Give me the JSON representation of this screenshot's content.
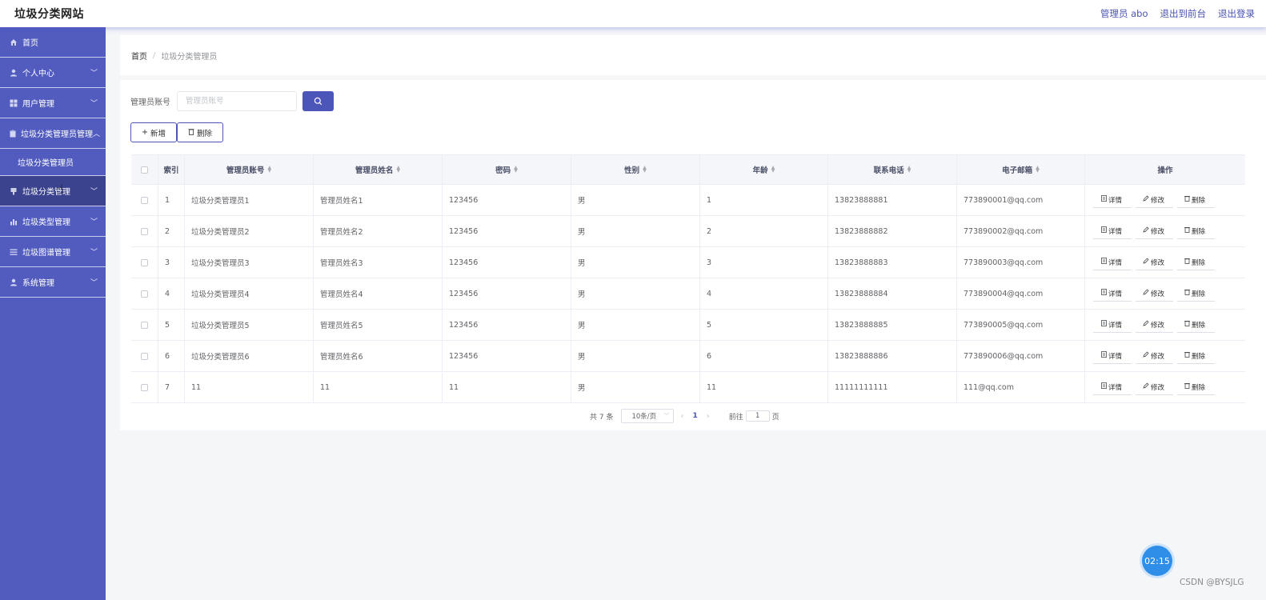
{
  "header": {
    "site_title": "垃圾分类网站",
    "admin_label": "管理员 abo",
    "to_front_label": "退出到前台",
    "logout_label": "退出登录"
  },
  "sidebar": {
    "items": [
      {
        "label": "首页",
        "icon": "home-icon",
        "chevron": ""
      },
      {
        "label": "个人中心",
        "icon": "user-icon",
        "chevron": "﹀"
      },
      {
        "label": "用户管理",
        "icon": "grid-icon",
        "chevron": "﹀"
      },
      {
        "label": "垃圾分类管理员管理",
        "icon": "clipboard-icon",
        "chevron": "︿"
      },
      {
        "label": "垃圾分类管理",
        "icon": "trash-icon",
        "chevron": "﹀"
      },
      {
        "label": "垃圾类型管理",
        "icon": "bar-chart-icon",
        "chevron": "﹀"
      },
      {
        "label": "垃圾图谱管理",
        "icon": "list-icon",
        "chevron": "﹀"
      },
      {
        "label": "系统管理",
        "icon": "user-icon",
        "chevron": "﹀"
      }
    ],
    "submenu_label": "垃圾分类管理员"
  },
  "breadcrumb": {
    "home": "首页",
    "sep": "/",
    "current": "垃圾分类管理员"
  },
  "search": {
    "label": "管理员账号",
    "placeholder": "管理员账号",
    "value": ""
  },
  "actions": {
    "add_label": "新增",
    "delete_label": "删除"
  },
  "table": {
    "headers": {
      "index": "索引",
      "account": "管理员账号",
      "name": "管理员姓名",
      "password": "密码",
      "gender": "性别",
      "age": "年龄",
      "phone": "联系电话",
      "email": "电子邮箱",
      "ops": "操作"
    },
    "op_labels": {
      "detail": "详情",
      "edit": "修改",
      "delete": "删除"
    },
    "rows": [
      {
        "index": "1",
        "account": "垃圾分类管理员1",
        "name": "管理员姓名1",
        "password": "123456",
        "gender": "男",
        "age": "1",
        "phone": "13823888881",
        "email": "773890001@qq.com"
      },
      {
        "index": "2",
        "account": "垃圾分类管理员2",
        "name": "管理员姓名2",
        "password": "123456",
        "gender": "男",
        "age": "2",
        "phone": "13823888882",
        "email": "773890002@qq.com"
      },
      {
        "index": "3",
        "account": "垃圾分类管理员3",
        "name": "管理员姓名3",
        "password": "123456",
        "gender": "男",
        "age": "3",
        "phone": "13823888883",
        "email": "773890003@qq.com"
      },
      {
        "index": "4",
        "account": "垃圾分类管理员4",
        "name": "管理员姓名4",
        "password": "123456",
        "gender": "男",
        "age": "4",
        "phone": "13823888884",
        "email": "773890004@qq.com"
      },
      {
        "index": "5",
        "account": "垃圾分类管理员5",
        "name": "管理员姓名5",
        "password": "123456",
        "gender": "男",
        "age": "5",
        "phone": "13823888885",
        "email": "773890005@qq.com"
      },
      {
        "index": "6",
        "account": "垃圾分类管理员6",
        "name": "管理员姓名6",
        "password": "123456",
        "gender": "男",
        "age": "6",
        "phone": "13823888886",
        "email": "773890006@qq.com"
      },
      {
        "index": "7",
        "account": "11",
        "name": "11",
        "password": "11",
        "gender": "男",
        "age": "11",
        "phone": "11111111111",
        "email": "111@qq.com"
      }
    ]
  },
  "pagination": {
    "total_label": "共 7 条",
    "page_size": "10条/页",
    "current_page": "1",
    "goto_prefix": "前往",
    "goto_value": "1",
    "goto_suffix": "页"
  },
  "timer": "02:15",
  "watermark": "CSDN @BYSJLG",
  "colors": {
    "accent": "#525cbf",
    "active": "#3b438f",
    "timer": "#2f8fe8"
  }
}
